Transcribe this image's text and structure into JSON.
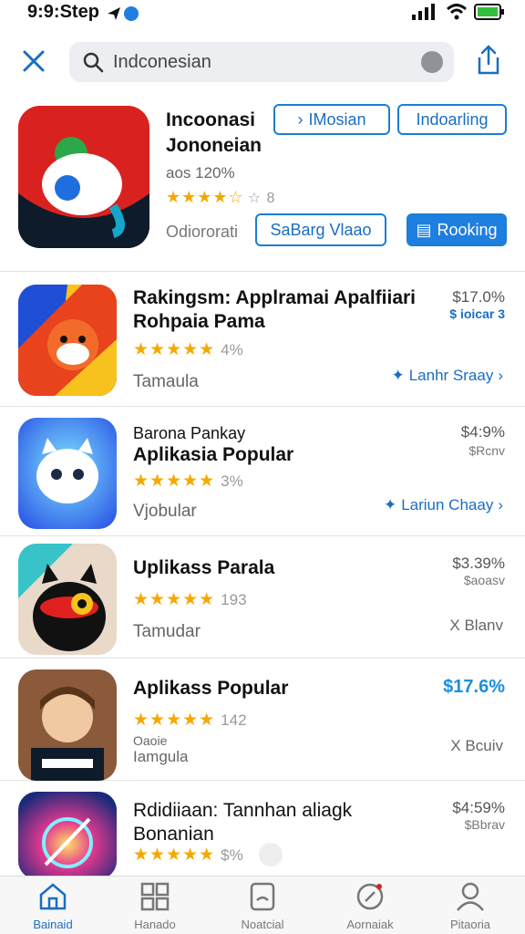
{
  "status": {
    "time": "9:9:Step"
  },
  "search": {
    "query": "Indconesian"
  },
  "hero": {
    "title": "Incoonasi Jononeian",
    "subtitle": "aos 120%",
    "rating_suffix": "☆ 8",
    "developer": "Odiororati",
    "chip1": "IMosian",
    "chip2": "Indoarling",
    "btn_outline": "SaBarg Vlaao",
    "btn_solid": "Rooking"
  },
  "apps": [
    {
      "title": "Rakingsm: Applramai Apalfiiari Rohpaia Pama",
      "rating_count": "4%",
      "subtitle": "Tamaula",
      "price": "$17.0%",
      "price_note": "$ ioicar 3",
      "action": "Lanhr Sraay"
    },
    {
      "title_small": "Barona Pankay",
      "title": "Aplikasia Popular",
      "rating_count": "3%",
      "subtitle": "Vjobular",
      "price": "$4:9%",
      "price_note": "$Rcnv",
      "action": "Lariun Chaay"
    },
    {
      "title": "Uplikass Parala",
      "rating_count": "193",
      "subtitle": "Tamudar",
      "price": "$3.39%",
      "price_note": "$aoasv",
      "action": "X Blanv"
    },
    {
      "title": "Aplikass Popular",
      "rating_count": "142",
      "subtitle_small": "Oaoie",
      "subtitle": "Iamgula",
      "price": "$17.6%",
      "price_note": "",
      "action": "X Bcuiv"
    },
    {
      "title": "Rdidiiaan: Tannhan aliagk Bonanian",
      "rating_count": "$%",
      "subtitle": "",
      "price": "$4:59%",
      "price_note": "$Bbrav",
      "action": ""
    }
  ],
  "tabs": [
    {
      "label": "Bainaid"
    },
    {
      "label": "Hanado"
    },
    {
      "label": "Noatcial"
    },
    {
      "label": "Aornaiak"
    },
    {
      "label": "Pitaoria"
    }
  ],
  "colors": {
    "accent": "#1e7fe0",
    "star": "#f5a800"
  }
}
